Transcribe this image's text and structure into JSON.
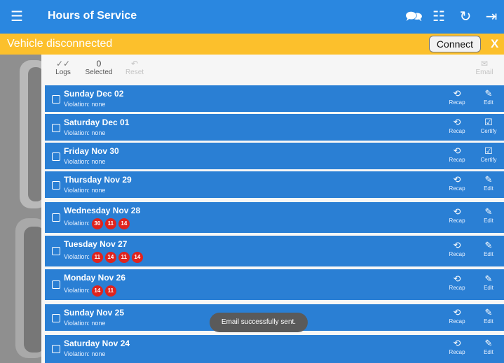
{
  "appbar": {
    "title": "Hours of Service",
    "icons": [
      "menu-icon",
      "message-icon",
      "excel-icon",
      "refresh-icon",
      "logout-icon"
    ]
  },
  "banner": {
    "message": "Vehicle disconnected",
    "connect_label": "Connect",
    "close_label": "X"
  },
  "toolbar": {
    "logs_label": "Logs",
    "selected_count": "0",
    "selected_label": "Selected",
    "reset_label": "Reset",
    "email_label": "Email"
  },
  "rows": [
    {
      "title": "Sunday Dec 02",
      "violation": "Violation: none",
      "badges": [],
      "left_action": "Recap",
      "right_action": "Edit"
    },
    {
      "title": "Saturday Dec 01",
      "violation": "Violation: none",
      "badges": [],
      "left_action": "Recap",
      "right_action": "Certify"
    },
    {
      "title": "Friday Nov 30",
      "violation": "Violation: none",
      "badges": [],
      "left_action": "Recap",
      "right_action": "Certify"
    },
    {
      "title": "Thursday Nov 29",
      "violation": "Violation: none",
      "badges": [],
      "left_action": "Recap",
      "right_action": "Edit"
    },
    {
      "title": "Wednesday Nov 28",
      "violation": "Violation:",
      "badges": [
        "30",
        "11",
        "14"
      ],
      "left_action": "Recap",
      "right_action": "Edit"
    },
    {
      "title": "Tuesday Nov 27",
      "violation": "Violation:",
      "badges": [
        "11",
        "14",
        "11",
        "14"
      ],
      "left_action": "Recap",
      "right_action": "Edit"
    },
    {
      "title": "Monday Nov 26",
      "violation": "Violation:",
      "badges": [
        "14",
        "11"
      ],
      "left_action": "Recap",
      "right_action": "Edit"
    },
    {
      "title": "Sunday Nov 25",
      "violation": "Violation: none",
      "badges": [],
      "left_action": "Recap",
      "right_action": "Edit"
    },
    {
      "title": "Saturday Nov 24",
      "violation": "Violation: none",
      "badges": [],
      "left_action": "Recap",
      "right_action": "Edit"
    }
  ],
  "toast": {
    "message": "Email successfully sent."
  },
  "colors": {
    "primary": "#2a87e0",
    "row": "#2a7fd4",
    "banner": "#fcc02c",
    "badge": "#e0231d"
  }
}
